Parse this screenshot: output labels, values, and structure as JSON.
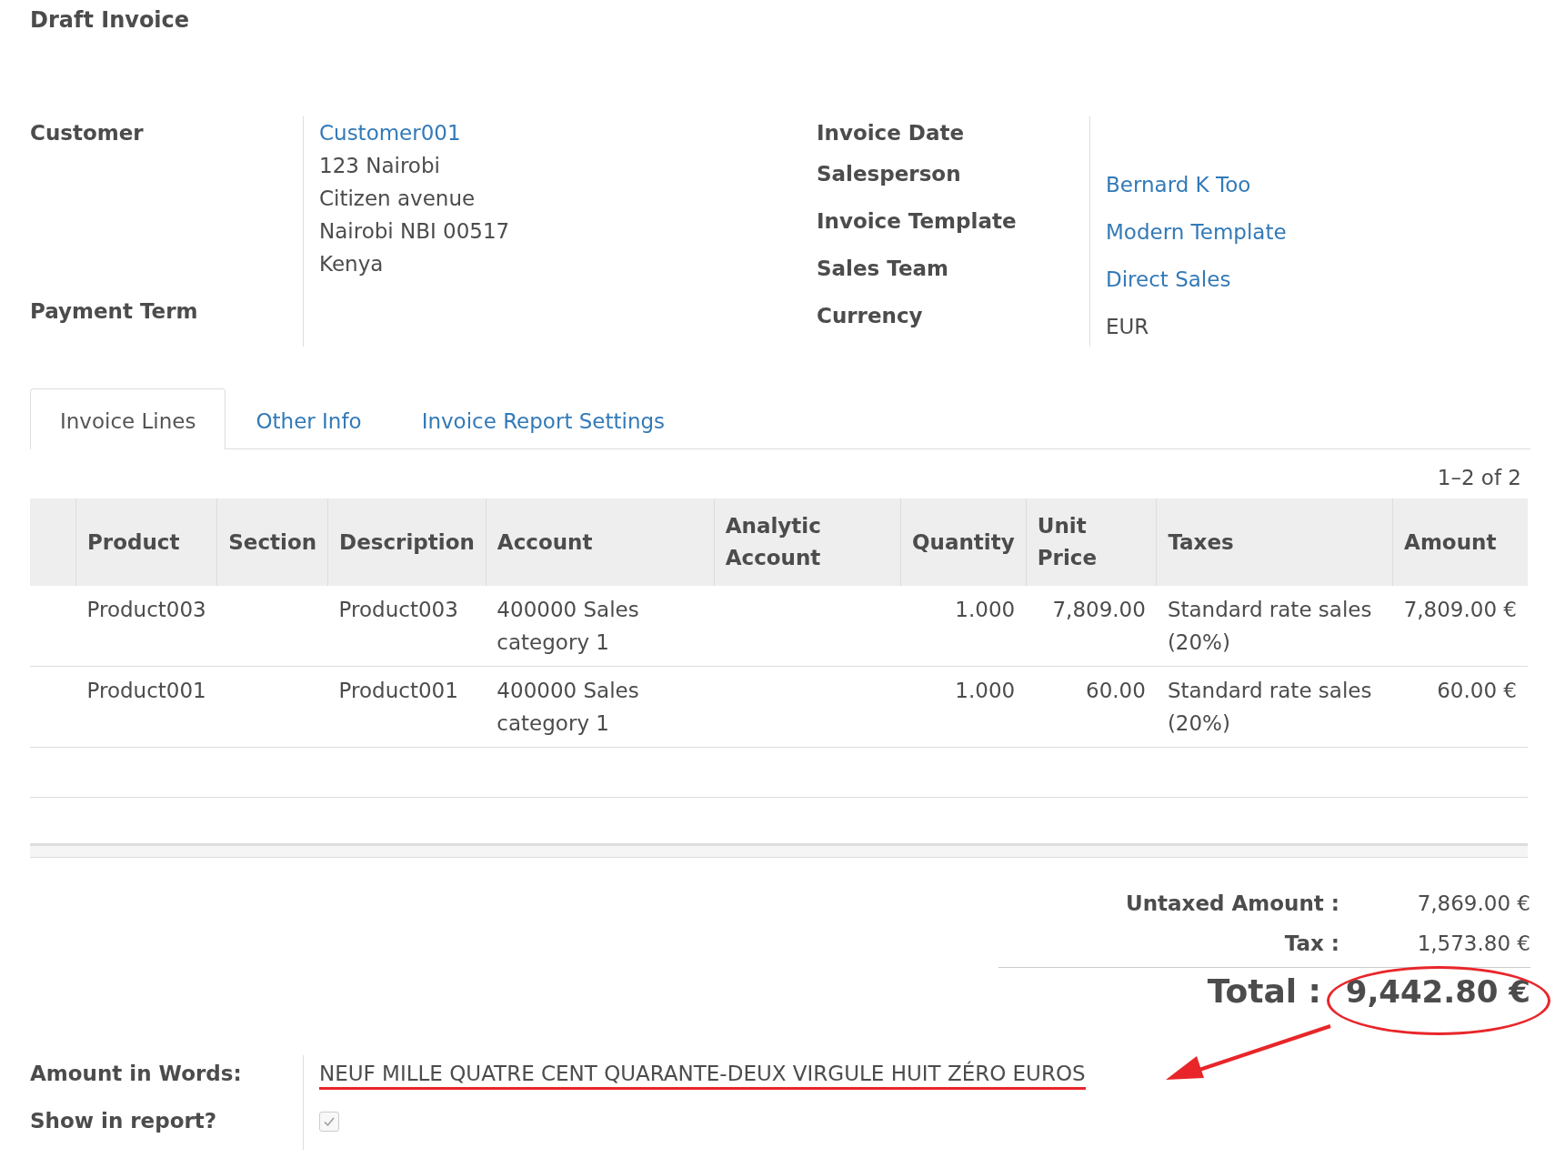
{
  "title": "Draft Invoice",
  "left_fields": [
    {
      "label": "Customer",
      "lines": [
        {
          "text": "Customer001",
          "link": true
        },
        {
          "text": "123 Nairobi",
          "link": false
        },
        {
          "text": "Citizen avenue",
          "link": false
        },
        {
          "text": "Nairobi NBI 00517",
          "link": false
        },
        {
          "text": "Kenya",
          "link": false
        }
      ]
    },
    {
      "label": "Payment Term"
    }
  ],
  "right_fields": [
    {
      "label": "Invoice Date"
    },
    {
      "label": "Salesperson",
      "value": "Bernard K Too",
      "link": true
    },
    {
      "label": "Invoice Template",
      "value": "Modern Template",
      "link": true
    },
    {
      "label": "Sales Team",
      "value": "Direct Sales",
      "link": true
    },
    {
      "label": "Currency",
      "value": "EUR",
      "link": false
    }
  ],
  "tabs": [
    {
      "label": "Invoice Lines",
      "selected": true
    },
    {
      "label": "Other Info",
      "selected": false
    },
    {
      "label": "Invoice Report Settings",
      "selected": false
    }
  ],
  "pager": "1–2 of 2",
  "table": {
    "columns": [
      {
        "label": "Product",
        "kind": "text"
      },
      {
        "label": "Section",
        "kind": "text"
      },
      {
        "label": "Description",
        "kind": "text"
      },
      {
        "label": "Account",
        "kind": "text"
      },
      {
        "label": "Analytic Account",
        "kind": "text"
      },
      {
        "label": "Quantity",
        "kind": "number"
      },
      {
        "label": "Unit Price",
        "kind": "number"
      },
      {
        "label": "Taxes",
        "kind": "text"
      },
      {
        "label": "Amount",
        "kind": "number"
      }
    ],
    "rows": [
      [
        "Product003",
        "",
        "Product003",
        "400000 Sales category 1",
        "",
        "1.000",
        "7,809.00",
        "Standard rate sales (20%)",
        "7,809.00 €"
      ],
      [
        "Product001",
        "",
        "Product001",
        "400000 Sales category 1",
        "",
        "1.000",
        "60.00",
        "Standard rate sales (20%)",
        "60.00 €"
      ]
    ]
  },
  "totals": [
    {
      "label": "Untaxed Amount :",
      "value": "7,869.00 €"
    },
    {
      "label": "Tax :",
      "value": "1,573.80 €"
    }
  ],
  "total": {
    "label": "Total :",
    "value": "9,442.80 €",
    "circled": true
  },
  "amount_in_words": {
    "label": "Amount in Words:",
    "value": "NEUF MILLE QUATRE CENT QUARANTE-DEUX VIRGULE HUIT ZÉRO EUROS",
    "underlined": true,
    "arrow": true
  },
  "show_in_report": {
    "label": "Show in report?",
    "checked": true
  }
}
